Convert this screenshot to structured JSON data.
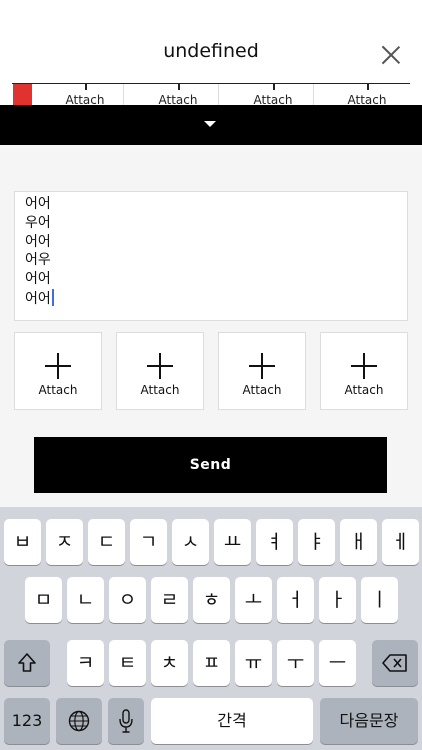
{
  "header": {
    "title": "undefined",
    "close_icon": "close-icon"
  },
  "strip": {
    "labels": [
      "Attach",
      "Attach",
      "Attach",
      "Attach"
    ],
    "accent_color": "#e0322f"
  },
  "collapse": {
    "icon": "caret-down-icon"
  },
  "message": {
    "lines": [
      "어어",
      "우어",
      "어어",
      "어우",
      "어어",
      "어어"
    ]
  },
  "attachments": [
    {
      "label": "Attach",
      "icon": "plus-icon"
    },
    {
      "label": "Attach",
      "icon": "plus-icon"
    },
    {
      "label": "Attach",
      "icon": "plus-icon"
    },
    {
      "label": "Attach",
      "icon": "plus-icon"
    }
  ],
  "send": {
    "label": "Send"
  },
  "keyboard": {
    "row1": [
      "ㅂ",
      "ㅈ",
      "ㄷ",
      "ㄱ",
      "ㅅ",
      "ㅛ",
      "ㅕ",
      "ㅑ",
      "ㅐ",
      "ㅔ"
    ],
    "row2": [
      "ㅁ",
      "ㄴ",
      "ㅇ",
      "ㄹ",
      "ㅎ",
      "ㅗ",
      "ㅓ",
      "ㅏ",
      "ㅣ"
    ],
    "row3": [
      "ㅋ",
      "ㅌ",
      "ㅊ",
      "ㅍ",
      "ㅠ",
      "ㅜ",
      "ㅡ"
    ],
    "numbers_label": "123",
    "space_label": "간격",
    "return_label": "다음문장",
    "shift_icon": "shift-icon",
    "backspace_icon": "backspace-icon",
    "globe_icon": "globe-icon",
    "mic_icon": "microphone-icon"
  }
}
